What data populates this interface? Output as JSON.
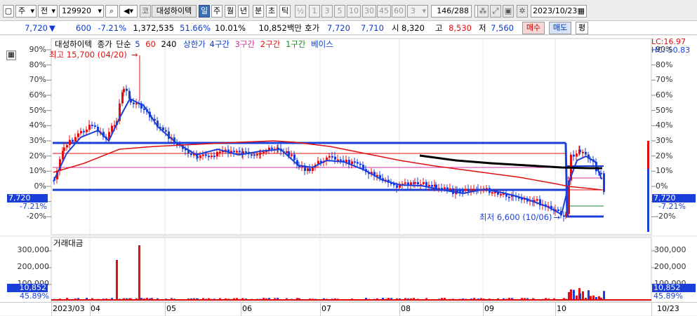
{
  "toolbar": {
    "period": "주",
    "prev": "전",
    "code": "129920",
    "market": "코",
    "name": "대성하이텍",
    "periods": [
      "일",
      "주",
      "월",
      "년",
      "분",
      "초",
      "틱"
    ],
    "half": "½",
    "intervals": [
      "1",
      "3",
      "5",
      "10",
      "30",
      "45",
      "60"
    ],
    "interval_select": "3",
    "page": "146/288",
    "date": "2023/10/23"
  },
  "info": {
    "price": "7,720",
    "change": "600",
    "change_pct": "-7.21%",
    "volume": "1,372,535",
    "ratio": "51.66%",
    "turnover": "10.01%",
    "amount": "10,852백만",
    "quote_label": "호가",
    "ask": "7,720",
    "bid": "7,710",
    "open_label": "시",
    "open": "8,320",
    "high_label": "고",
    "high": "8,530",
    "low_label": "저",
    "low": "7,560",
    "buy": "매수",
    "sell": "매도",
    "eval": "평"
  },
  "legend": {
    "name": "대성하이텍",
    "close": "종가",
    "simple": "단순",
    "ma5": "5",
    "ma60": "60",
    "ma240": "240",
    "upper_limit": "상한가",
    "zone4": "4구간",
    "zone3": "3구간",
    "zone2": "2구간",
    "zone1": "1구간",
    "base": "베이스"
  },
  "annotations": {
    "max": "최고 15,700 (04/20)",
    "min": "최저 6,600 (10/06)",
    "lc": "LC:16.97",
    "hc": "HC:-50.83"
  },
  "price_axis": {
    "labels": [
      "90%",
      "80%",
      "70%",
      "60%",
      "50%",
      "40%",
      "30%",
      "20%",
      "10%",
      "0%",
      "-10%",
      "-20%"
    ],
    "current_price": "7,720",
    "current_pct": "-7.21%"
  },
  "volume_pane": {
    "title": "거래대금",
    "labels": [
      "300,000",
      "200,000",
      "100,000"
    ],
    "current": "10,852",
    "pct": "45.89%"
  },
  "x_axis": {
    "labels": [
      "2023/03",
      "04",
      "05",
      "06",
      "07",
      "08",
      "09",
      "10"
    ],
    "last": "10/23"
  },
  "colors": {
    "up": "#e01010",
    "down": "#1a3fd8",
    "ma5": "#1a3fd8",
    "ma60": "#e01010",
    "ma240": "#000000",
    "zone4": "#1a3fd8",
    "zone3": "#d0309c",
    "zone2": "#e01010",
    "zone1": "#1a8a2a"
  }
}
